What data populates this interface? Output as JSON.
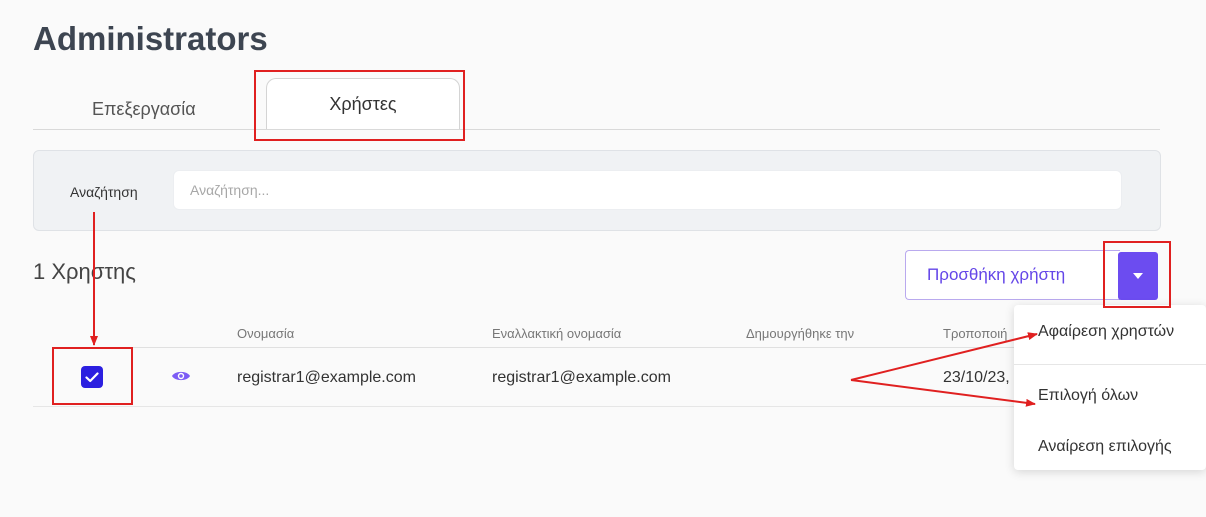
{
  "page": {
    "title": "Administrators"
  },
  "tabs": [
    {
      "label": "Επεξεργασία",
      "active": false
    },
    {
      "label": "Χρήστες",
      "active": true
    }
  ],
  "search": {
    "label": "Αναζήτηση",
    "placeholder": "Αναζήτηση...",
    "value": ""
  },
  "users": {
    "count_label": "1 Χρηστης"
  },
  "actions": {
    "add_user_label": "Προσθήκη χρήστη",
    "dropdown_icon": "caret-down-icon"
  },
  "table": {
    "columns": [
      "Ονομασία",
      "Εναλλακτική ονομασία",
      "Δημουργήθηκε την",
      "Τροποποιή"
    ],
    "rows": [
      {
        "checked": true,
        "name": "registrar1@example.com",
        "alt_name": "registrar1@example.com",
        "created": "",
        "modified": "23/10/23,"
      }
    ]
  },
  "dropdown_menu": {
    "items": [
      "Αφαίρεση χρηστών",
      "Επιλογή όλων",
      "Αναίρεση επιλογής"
    ]
  },
  "colors": {
    "accent": "#6c4cf0",
    "checkbox": "#2b1fe0",
    "annotation": "#e02020"
  }
}
